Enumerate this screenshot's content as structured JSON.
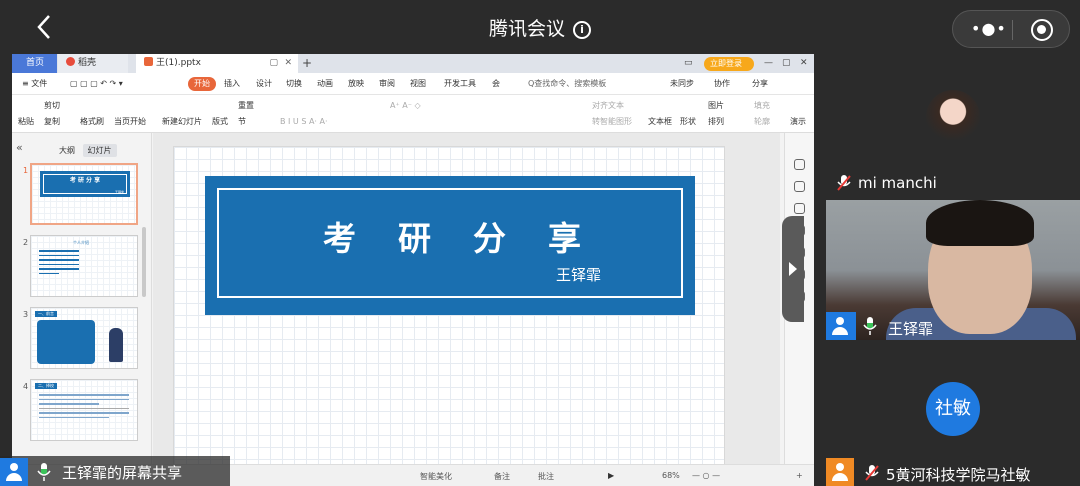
{
  "app": {
    "title": "腾讯会议"
  },
  "screen": {
    "tabs": {
      "home": "首页",
      "daoke": "稻壳",
      "file": "王(1).pptx",
      "login": "立即登录"
    },
    "menu": [
      {
        "label": "≡ 文件"
      },
      {
        "label": "开始",
        "active": true
      },
      {
        "label": "插入"
      },
      {
        "label": "设计"
      },
      {
        "label": "切换"
      },
      {
        "label": "动画"
      },
      {
        "label": "放映"
      },
      {
        "label": "审阅"
      },
      {
        "label": "视图"
      },
      {
        "label": "开发工具"
      },
      {
        "label": "会"
      }
    ],
    "search_placeholder": "Q查找命令、搜索模板",
    "menu_right": {
      "unsync": "未同步",
      "collab": "协作",
      "share": "分享"
    },
    "ribbon": {
      "paste": "粘贴",
      "cut": "剪切",
      "copy": "复制",
      "format_painter": "格式刷",
      "from_current": "当页开始",
      "new_slide": "新建幻灯片",
      "layout": "版式",
      "section": "节",
      "reset": "重置",
      "text_box": "文本框",
      "shape": "形状",
      "arrange": "排列",
      "image": "图片",
      "fill": "填充",
      "outline": "轮廓",
      "present": "演示",
      "align_text": "对齐文本",
      "smart_art": "转智能图形"
    },
    "panel": {
      "outline": "大纲",
      "slides": "幻灯片"
    },
    "thumbs": [
      {
        "num": "1",
        "title": "考 研 分 享",
        "sub": "王铎霏"
      },
      {
        "num": "2",
        "title": "个人介绍"
      },
      {
        "num": "3",
        "title": "一、前言"
      },
      {
        "num": "4",
        "title": "二、择校"
      }
    ],
    "slide": {
      "title": "考研分享",
      "subtitle": "王铎霏"
    },
    "statusbar": {
      "smart": "智能美化",
      "notes": "备注",
      "comment": "批注",
      "zoom": "68%"
    }
  },
  "sharer": {
    "label": "王铎霏的屏幕共享"
  },
  "participants": [
    {
      "name": "mi manchi",
      "muted": true
    },
    {
      "name": "王铎霏",
      "muted": false
    },
    {
      "name": "5黄河科技学院马社敏",
      "avatar_text": "社敏",
      "muted": true
    }
  ],
  "colors": {
    "slide_blue": "#1a6fb0",
    "accent_orange": "#e8663a",
    "avatar_blue": "#1f7ae0"
  }
}
